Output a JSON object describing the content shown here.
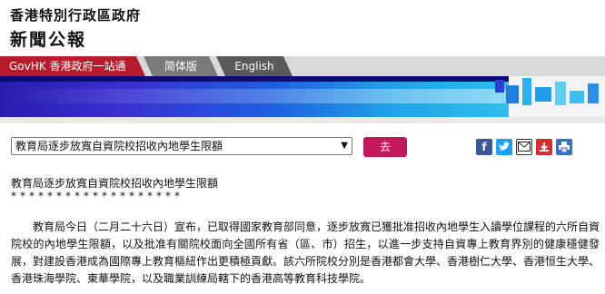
{
  "header": {
    "gov_name": "香港特別行政區政府",
    "press_title": "新聞公報"
  },
  "nav": {
    "govhk": "GovHK 香港政府一站通",
    "simplified": "简体版",
    "english": "English"
  },
  "select": {
    "selected": "教育局逐步放寬自資院校招收內地學生限額"
  },
  "go_button": "去",
  "share_icons": [
    "facebook-icon",
    "twitter-icon",
    "email-icon",
    "download-icon",
    "print-icon"
  ],
  "colors": {
    "govhk_red": "#b71c2c",
    "go_button": "#c2185b",
    "facebook": "#3b5998",
    "twitter": "#1da1f2",
    "download": "#d32f2f",
    "print": "#3a6fc4"
  },
  "article": {
    "title": "教育局逐步放寬自資院校招收內地學生限額",
    "stars": "*******************",
    "paragraph": "教育局今日（二月二十六日）宣布，已取得國家教育部同意，逐步放寬已獲批准招收內地學生入讀學位課程的六所自資院校的內地學生限額，以及批准有關院校面向全國所有省（區、市）招生，以進一步支持自資專上教育界別的健康穩健發展，對建設香港成為國際專上教育樞紐作出更積極貢獻。該六所院校分別是香港都會大學、香港樹仁大學、香港恒生大學、香港珠海學院、東華學院，以及職業訓練局轄下的香港高等教育科技學院。"
  }
}
